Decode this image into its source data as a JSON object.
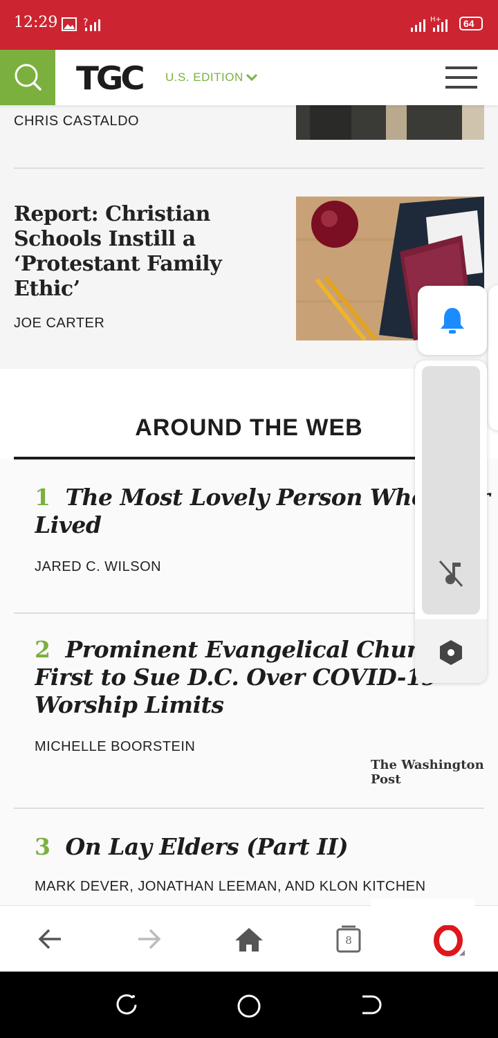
{
  "status_bar": {
    "time": "12:29",
    "battery": "64"
  },
  "header": {
    "logo": "TGC",
    "edition": "U.S. EDITION"
  },
  "feed": {
    "prev_author": "CHRIS CASTALDO",
    "article": {
      "title": "Report: Christian Schools Instill a ‘Protestant Family Ethic’",
      "author": "JOE CARTER"
    }
  },
  "around_web": {
    "heading": "AROUND THE WEB",
    "items": [
      {
        "rank": "1",
        "title": "The Most Lovely Person Who Ever Lived",
        "author": "JARED C. WILSON",
        "source": ""
      },
      {
        "rank": "2",
        "title": "Prominent Evangelical Church Is First to Sue D.C. Over COVID-19 Worship Limits",
        "author": "MICHELLE BOORSTEIN",
        "source": "The Washington Post"
      },
      {
        "rank": "3",
        "title": "On Lay Elders (Part II)",
        "author": "MARK DEVER, JONATHAN LEEMAN, AND KLON KITCHEN",
        "source": ""
      }
    ]
  },
  "bottom_nav": {
    "tabs_count": "8"
  },
  "colors": {
    "status_red": "#cd2431",
    "tgc_green": "#7bb03f",
    "bell_blue": "#1a8cff",
    "opera_red": "#e0161d"
  }
}
